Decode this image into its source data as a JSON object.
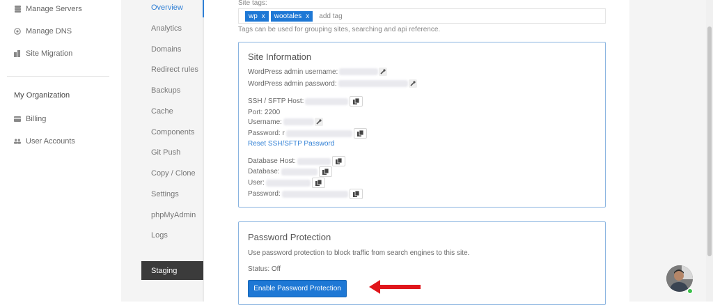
{
  "sidebar": {
    "items": [
      {
        "label": "Manage Servers",
        "icon": "server-icon"
      },
      {
        "label": "Manage DNS",
        "icon": "globe-icon"
      },
      {
        "label": "Site Migration",
        "icon": "migration-icon"
      }
    ],
    "org_heading": "My Organization",
    "org_items": [
      {
        "label": "Billing",
        "icon": "billing-icon"
      },
      {
        "label": "User Accounts",
        "icon": "users-icon"
      }
    ]
  },
  "subnav": {
    "items": [
      "Overview",
      "Analytics",
      "Domains",
      "Redirect rules",
      "Backups",
      "Cache",
      "Components",
      "Git Push",
      "Copy / Clone",
      "Settings",
      "phpMyAdmin",
      "Logs"
    ],
    "active": "Overview",
    "staging": "Staging"
  },
  "tags": {
    "label": "Site tags:",
    "items": [
      "wp",
      "wootales"
    ],
    "remove_glyph": "x",
    "placeholder": "add tag",
    "help": "Tags can be used for grouping sites, searching and api reference."
  },
  "site_info": {
    "title": "Site Information",
    "wp_user_label": "WordPress admin username:",
    "wp_pass_label": "WordPress admin password:",
    "ssh_host_label": "SSH / SFTP Host:",
    "port_label": "Port: 2200",
    "username_label": "Username:",
    "password_label": "Password: r",
    "reset_link": "Reset SSH/SFTP Password",
    "db_host_label": "Database Host:",
    "db_label": "Database:",
    "db_user_label": "User:",
    "db_pass_label": "Password:"
  },
  "password_protection": {
    "title": "Password Protection",
    "description": "Use password protection to block traffic from search engines to this site.",
    "status": "Status: Off",
    "button": "Enable Password Protection"
  },
  "colors": {
    "accent": "#1e78d5",
    "link": "#2f7fd5",
    "arrow": "#e0161b",
    "staging_bg": "#3b3b3b"
  }
}
